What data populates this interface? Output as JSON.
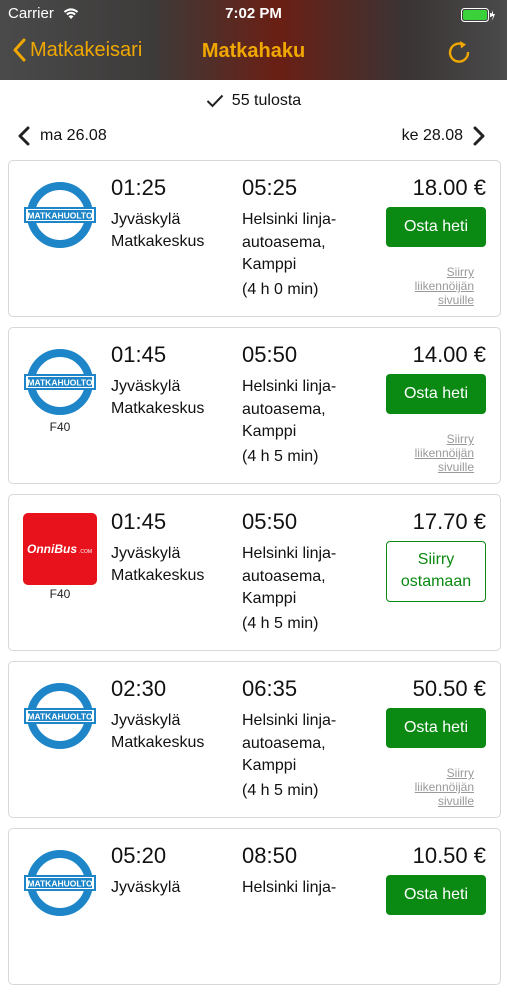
{
  "status_bar": {
    "carrier": "Carrier",
    "time": "7:02 PM"
  },
  "nav": {
    "back_label": "Matkakeisari",
    "title": "Matkahaku"
  },
  "results": {
    "count_text": "55 tulosta"
  },
  "dates": {
    "prev": "ma 26.08",
    "next": "ke 28.08"
  },
  "colors": {
    "accent": "#f0a800",
    "buy_green": "#0a8a12",
    "matkahuolto_blue": "#1e86c8",
    "onnibus_red": "#e8121c"
  },
  "trips": [
    {
      "operator": "MATKAHUOLTO",
      "tag": "",
      "depart": "01:25",
      "arrive": "05:25",
      "from_line1": "Jyväskylä",
      "from_line2": "Matkakeskus",
      "to_line1": "Helsinki linja-",
      "to_line2": "autoasema,",
      "to_line3": "Kamppi",
      "duration": "(4 h 0 min)",
      "price": "18.00 €",
      "action": "Osta heti",
      "link1": "Siirry",
      "link2": "liikennöijän",
      "link3": "sivuille"
    },
    {
      "operator": "MATKAHUOLTO",
      "tag": "F40",
      "depart": "01:45",
      "arrive": "05:50",
      "from_line1": "Jyväskylä",
      "from_line2": "Matkakeskus",
      "to_line1": "Helsinki linja-",
      "to_line2": "autoasema,",
      "to_line3": "Kamppi",
      "duration": "(4 h 5 min)",
      "price": "14.00 €",
      "action": "Osta heti",
      "link1": "Siirry",
      "link2": "liikennöijän",
      "link3": "sivuille"
    },
    {
      "operator": "OnniBus",
      "tag": "F40",
      "depart": "01:45",
      "arrive": "05:50",
      "from_line1": "Jyväskylä",
      "from_line2": "Matkakeskus",
      "to_line1": "Helsinki linja-",
      "to_line2": "autoasema,",
      "to_line3": "Kamppi",
      "duration": "(4 h 5 min)",
      "price": "17.70 €",
      "action_line1": "Siirry",
      "action_line2": "ostamaan"
    },
    {
      "operator": "MATKAHUOLTO",
      "tag": "",
      "depart": "02:30",
      "arrive": "06:35",
      "from_line1": "Jyväskylä",
      "from_line2": "Matkakeskus",
      "to_line1": "Helsinki linja-",
      "to_line2": "autoasema,",
      "to_line3": "Kamppi",
      "duration": "(4 h 5 min)",
      "price": "50.50 €",
      "action": "Osta heti",
      "link1": "Siirry",
      "link2": "liikennöijän",
      "link3": "sivuille"
    },
    {
      "operator": "MATKAHUOLTO",
      "tag": "",
      "depart": "05:20",
      "arrive": "08:50",
      "from_line1": "Jyväskylä",
      "to_line1": "Helsinki linja-",
      "price": "10.50 €",
      "action": "Osta heti"
    }
  ]
}
